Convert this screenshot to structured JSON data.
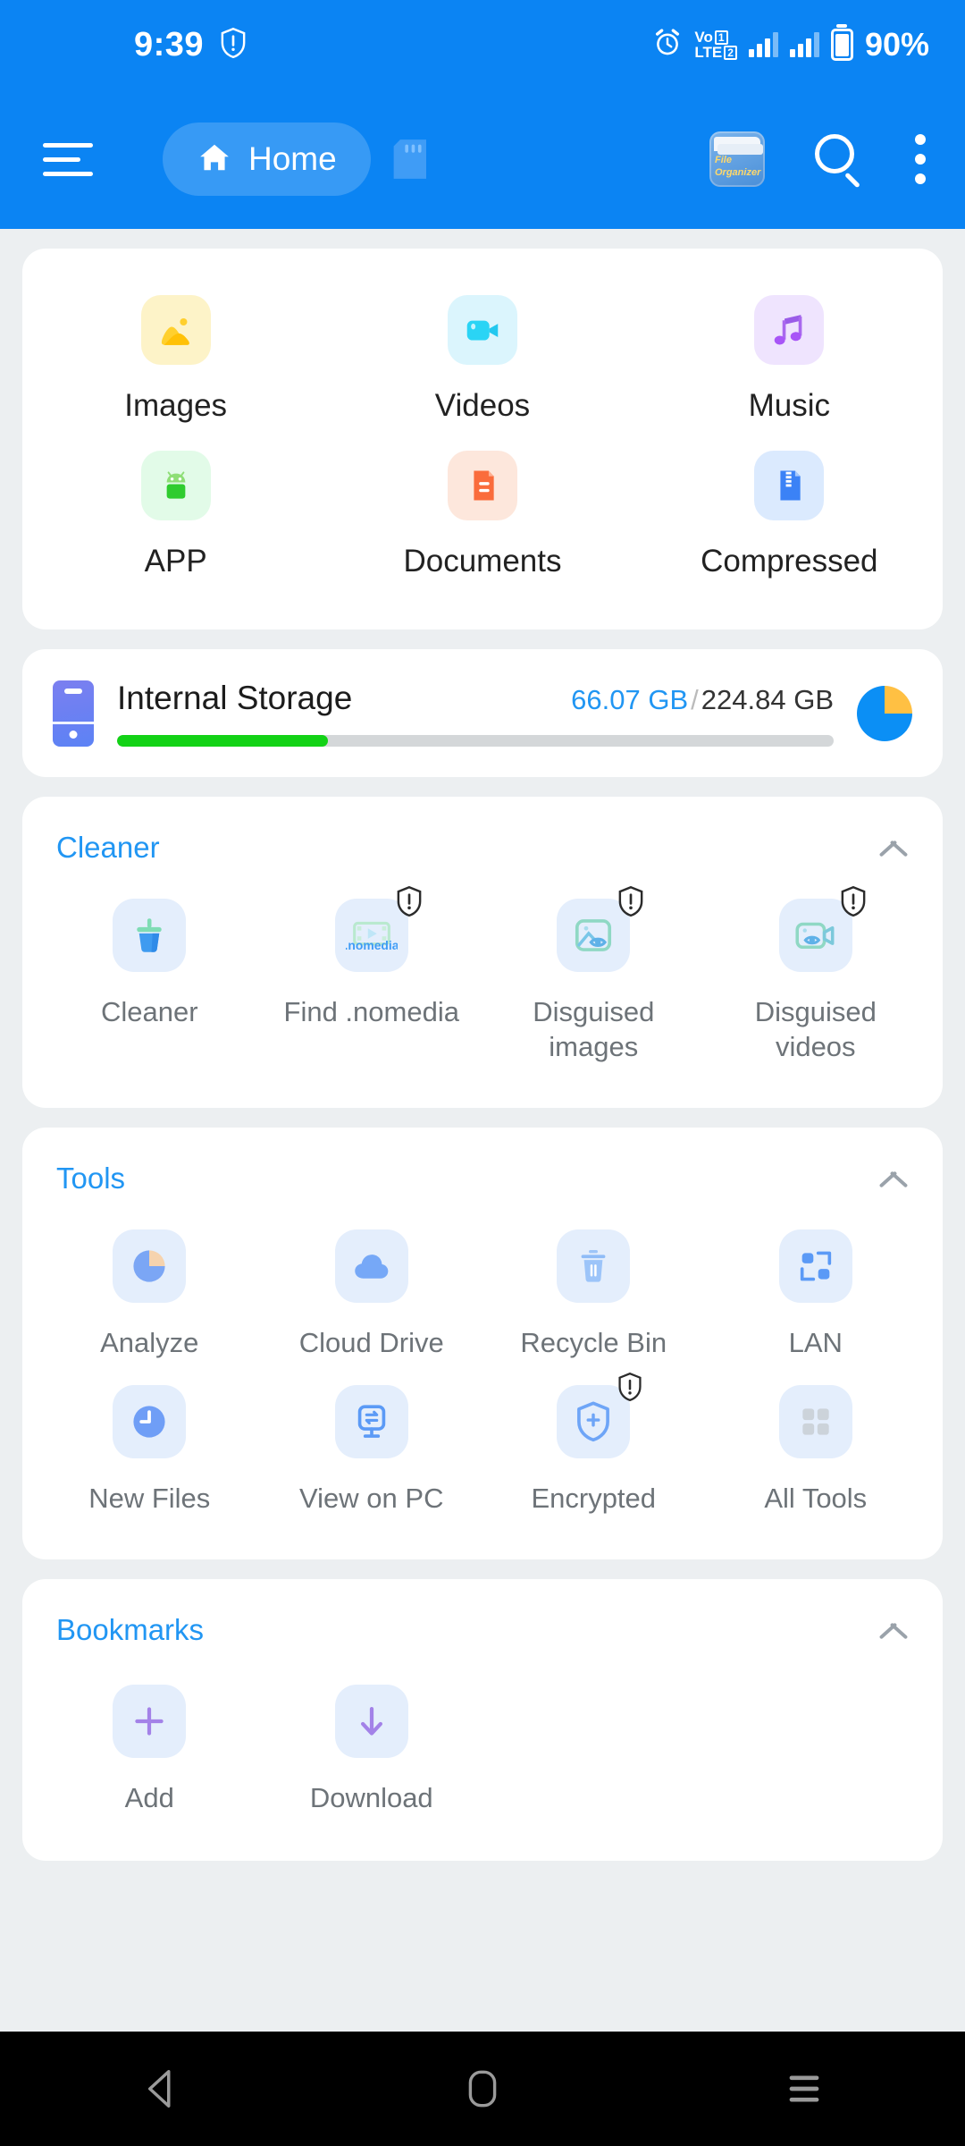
{
  "status_bar": {
    "time": "9:39",
    "shield_icon": "shield-exclamation-icon",
    "alarm_icon": "alarm-clock-icon",
    "volte_line1": "Vo",
    "volte_line2": "LTE",
    "sim_slot1": "1",
    "sim_slot2": "2",
    "battery_percent": "90%"
  },
  "app_bar": {
    "menu_icon": "hamburger-menu-icon",
    "home_label": "Home",
    "home_icon": "house-icon",
    "sd_card_icon": "sd-card-icon",
    "organizer_icon_line1": "File",
    "organizer_icon_line2": "Organizer",
    "search_icon": "search-icon",
    "overflow_icon": "more-vertical-icon"
  },
  "categories": [
    {
      "label": "Images",
      "icon": "image-icon",
      "tile_class": "tile-images"
    },
    {
      "label": "Videos",
      "icon": "video-icon",
      "tile_class": "tile-videos"
    },
    {
      "label": "Music",
      "icon": "music-note-icon",
      "tile_class": "tile-music"
    },
    {
      "label": "APP",
      "icon": "android-icon",
      "tile_class": "tile-app"
    },
    {
      "label": "Documents",
      "icon": "document-icon",
      "tile_class": "tile-docs"
    },
    {
      "label": "Compressed",
      "icon": "zip-file-icon",
      "tile_class": "tile-zip"
    }
  ],
  "storage": {
    "name": "Internal Storage",
    "used": "66.07 GB",
    "separator": "/",
    "total": "224.84 GB",
    "used_percent": 29.4,
    "bar_color": "#13d216",
    "used_color": "#2196f3",
    "phone_icon": "phone-storage-icon",
    "pie_icon": "pie-chart-icon"
  },
  "cleaner": {
    "title": "Cleaner",
    "collapse_icon": "chevron-up-icon",
    "items": [
      {
        "label": "Cleaner",
        "icon": "broom-icon",
        "badge": false
      },
      {
        "label": "Find .nomedia",
        "icon": "nomedia-file-icon",
        "badge": true
      },
      {
        "label": "Disguised images",
        "icon": "disguised-image-icon",
        "badge": true
      },
      {
        "label": "Disguised videos",
        "icon": "disguised-video-icon",
        "badge": true
      }
    ]
  },
  "tools": {
    "title": "Tools",
    "collapse_icon": "chevron-up-icon",
    "items": [
      {
        "label": "Analyze",
        "icon": "pie-chart-icon",
        "badge": false
      },
      {
        "label": "Cloud Drive",
        "icon": "cloud-icon",
        "badge": false
      },
      {
        "label": "Recycle Bin",
        "icon": "trash-icon",
        "badge": false
      },
      {
        "label": "LAN",
        "icon": "lan-network-icon",
        "badge": false
      },
      {
        "label": "New Files",
        "icon": "clock-icon",
        "badge": false
      },
      {
        "label": "View on PC",
        "icon": "monitor-sync-icon",
        "badge": false
      },
      {
        "label": "Encrypted",
        "icon": "shield-plus-icon",
        "badge": true
      },
      {
        "label": "All Tools",
        "icon": "grid-apps-icon",
        "badge": false
      }
    ]
  },
  "bookmarks": {
    "title": "Bookmarks",
    "collapse_icon": "chevron-up-icon",
    "items": [
      {
        "label": "Add",
        "icon": "plus-icon"
      },
      {
        "label": "Download",
        "icon": "download-arrow-icon"
      }
    ]
  },
  "nav_bar": {
    "back_icon": "back-triangle-icon",
    "home_icon": "home-rect-icon",
    "recents_icon": "recents-lines-icon"
  },
  "colors": {
    "brand_blue": "#0b84f3",
    "accent_blue": "#2196f3",
    "page_bg": "#eceff1",
    "card_bg": "#ffffff"
  }
}
